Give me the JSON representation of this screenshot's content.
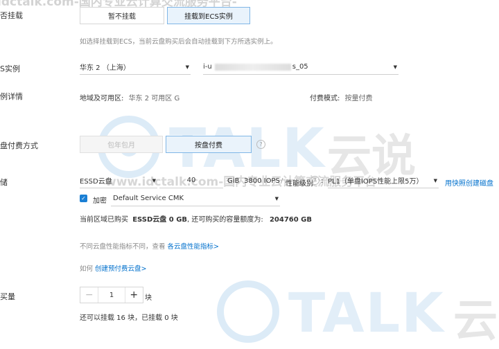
{
  "watermarks": {
    "top_text": "idctalk.com-国内专业云计算交流服务平台-",
    "mid_text": "www.idctalk.com-国内专业云计算交流服务平台",
    "logo_talk": "TALK",
    "logo_cn": "云说",
    "logo_cn_small": "云"
  },
  "mount": {
    "label": "否挂载",
    "options": [
      "暂不挂载",
      "挂载到ECS实例"
    ],
    "selected": "挂载到ECS实例",
    "hint": "如选择挂载到ECS，当前云盘购买后会自动挂载到下方所选实例上。"
  },
  "ecs_instance": {
    "label": "S实例",
    "region_value": "华东 2 （上海）",
    "instance_prefix": "i-u",
    "instance_suffix": "s_05"
  },
  "instance_detail": {
    "label": "例详情",
    "zone_label": "地域及可用区:",
    "zone_value": "华东 2 可用区 G",
    "billing_label": "付费模式:",
    "billing_value": "按量付费"
  },
  "billing_method": {
    "label": "盘付费方式",
    "options": [
      "包年包月",
      "按盘付费"
    ],
    "selected": "按盘付费",
    "help_icon": "question-circle-icon"
  },
  "storage": {
    "label": "储",
    "disk_type": "ESSD云盘",
    "size": "40",
    "unit": "GiB",
    "iops": "3800 IOPS",
    "perf_label": "性能级别",
    "perf_value": "PL1（单盘IOPS性能上限5万）",
    "snapshot_link": "用快照创建磁盘",
    "encrypt_label": "加密",
    "kms_value": "Default Service CMK",
    "quota_prefix": "当前区域已购买",
    "quota_bold": "ESSD云盘 0 GB",
    "quota_mid": ", 还可购买的容量额度为:",
    "quota_value": "204760 GB",
    "perf_hint": "不同云盘性能指标不同，查看",
    "perf_hint_link": "各云盘性能指标>",
    "howto_prefix": "如何",
    "howto_link": "创建预付费云盘>"
  },
  "quantity": {
    "label": "买量",
    "value": "1",
    "unit": "块",
    "hint": "还可以挂载 16 块，已挂载 0 块"
  }
}
